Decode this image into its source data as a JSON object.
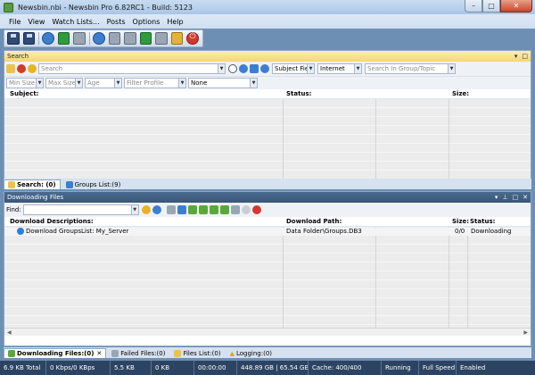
{
  "window": {
    "title": "Newsbin.nbi - Newsbin Pro 6.82RC1 - Build: 5123",
    "minimize": "–",
    "maximize": "□",
    "close": "✕"
  },
  "menu": [
    "File",
    "View",
    "Watch Lists...",
    "Posts",
    "Options",
    "Help"
  ],
  "search_panel": {
    "title": "Search",
    "search_placeholder": "Search",
    "subject_field": "Subject Field",
    "network": "Internet",
    "group_placeholder": "Search In Group/Topic",
    "min_size": "Min Size",
    "max_size": "Max Size",
    "age": "Age",
    "filter_profile": "Filter Profile",
    "none": "None",
    "columns": {
      "subject": "Subject:",
      "status": "Status:",
      "size": "Size:"
    }
  },
  "search_tabs": [
    {
      "label": "Search: (0)"
    },
    {
      "label": "Groups List:(9)"
    }
  ],
  "downloading_panel": {
    "title": "Downloading Files",
    "find_label": "Find:",
    "columns": {
      "desc": "Download Descriptions:",
      "path": "Download Path:",
      "size": "Size:",
      "status": "Status:"
    },
    "rows": [
      {
        "desc": "Download GroupsList: My_Server",
        "path": "Data Folder\\Groups.DB3",
        "size": "0/0",
        "status": "Downloading"
      }
    ]
  },
  "bottom_tabs": [
    {
      "label": "Downloading Files:(0)"
    },
    {
      "label": "Failed Files:(0)"
    },
    {
      "label": "Files List:(0)"
    },
    {
      "label": "Logging:(0)"
    }
  ],
  "status": {
    "total": "6.9 KB Total",
    "speed": "0 Kbps/0 KBps",
    "cache_size": "5.5 KB",
    "zero": "0 KB",
    "time": "00:00:00",
    "disk": "448.89 GB | 65.54 GB",
    "cache": "Cache: 400/400",
    "running": "Running",
    "full_speed": "Full Speed",
    "enabled": "Enabled"
  },
  "colors": {
    "accent": "#2c4462",
    "search_head": "#f5d675",
    "panel_head": "#3a5778"
  }
}
